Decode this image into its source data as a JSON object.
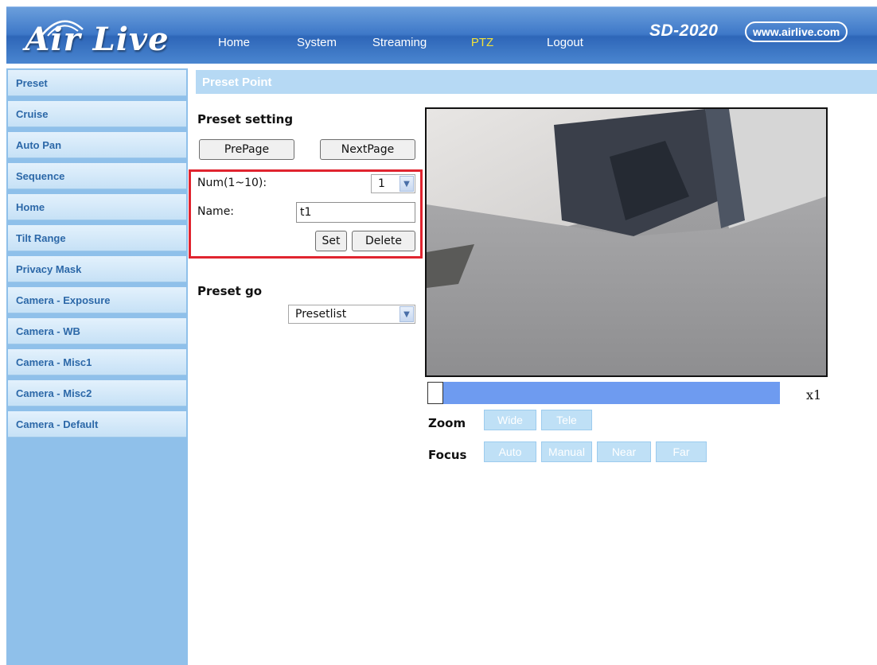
{
  "brand": {
    "logo": "Air Live",
    "model": "SD-2020",
    "site": "www.airlive.com"
  },
  "nav": {
    "items": [
      {
        "label": "Home"
      },
      {
        "label": "System"
      },
      {
        "label": "Streaming"
      },
      {
        "label": "PTZ",
        "active": true
      },
      {
        "label": "Logout"
      }
    ]
  },
  "sidebar": {
    "items": [
      {
        "label": "Preset"
      },
      {
        "label": "Cruise"
      },
      {
        "label": "Auto Pan"
      },
      {
        "label": "Sequence"
      },
      {
        "label": "Home"
      },
      {
        "label": "Tilt Range"
      },
      {
        "label": "Privacy Mask"
      },
      {
        "label": "Camera - Exposure"
      },
      {
        "label": "Camera - WB"
      },
      {
        "label": "Camera - Misc1"
      },
      {
        "label": "Camera - Misc2"
      },
      {
        "label": "Camera - Default"
      }
    ]
  },
  "section": {
    "title": "Preset Point"
  },
  "preset_setting": {
    "title": "Preset setting",
    "prepage": "PrePage",
    "nextpage": "NextPage",
    "num_label": "Num(1~10):",
    "num_value": "1",
    "name_label": "Name:",
    "name_value": "t1",
    "set": "Set",
    "delete": "Delete"
  },
  "preset_go": {
    "title": "Preset go",
    "select_value": "Presetlist"
  },
  "ptz": {
    "zoom_level_text": "x1",
    "zoom_label": "Zoom",
    "wide": "Wide",
    "tele": "Tele",
    "focus_label": "Focus",
    "auto": "Auto",
    "manual": "Manual",
    "near": "Near",
    "far": "Far"
  },
  "colors": {
    "header": "#3e78c8",
    "active_nav": "#f3e23a",
    "sidebar_bg": "#8fc0ea",
    "highlight_box": "#e0242f",
    "zoom_track": "#6e9bf0"
  }
}
